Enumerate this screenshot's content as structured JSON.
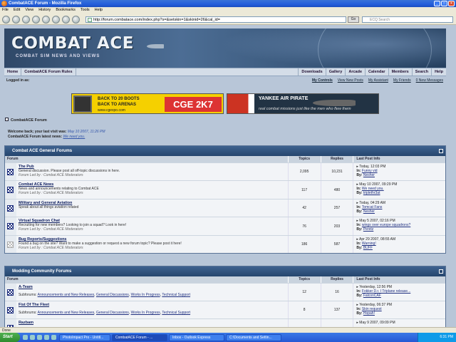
{
  "window": {
    "title": "CombatACE Forum - Mozilla Firefox"
  },
  "menu": [
    "File",
    "Edit",
    "View",
    "History",
    "Bookmarks",
    "Tools",
    "Help"
  ],
  "toolbar": {
    "url": "http://forum.combatace.com/index.php?s=&setskin=1&skinid=26&cal_id=",
    "go_label": "Go",
    "search_placeholder": "ECQ Search"
  },
  "banner": {
    "logo": "COMBAT ACE",
    "tagline": "COMBAT SIM NEWS AND VIEWS"
  },
  "nav": {
    "left": [
      "Home",
      "CombatACE Forum Rules"
    ],
    "right": [
      "Downloads",
      "Gallery",
      "Arcade",
      "Calendar",
      "Members",
      "Search",
      "Help"
    ]
  },
  "userbar": {
    "logged_in_as": "Logged in as:",
    "links": [
      "My Controls",
      "View New Posts",
      "My Assistant",
      "My Friends",
      "0 New Messages"
    ]
  },
  "ads": {
    "ad1": {
      "line1": "BACK TO 20 BOOTS",
      "line2": "BACK TO ARENAS",
      "url": "www.cgexpo.com",
      "brand": "CGE 2K7"
    },
    "ad2": {
      "title": "YANKEE AIR PIRATE",
      "sub": "real combat missions just like the men who flew them"
    }
  },
  "board": {
    "title": "CombatACE Forum"
  },
  "welcome": {
    "line1_prefix": "Welcome back; your last visit was:",
    "line1_value": "May 10 2007, 11:26 PM",
    "line2_prefix": "CombatACE Forum latest news:",
    "line2_value": "We need you."
  },
  "sections": [
    {
      "title": "Combat ACE General Forums",
      "columns": [
        "Forum",
        "Topics",
        "Replies",
        "Last Post Info"
      ],
      "rows": [
        {
          "name": "The Pub",
          "desc": "General discussion. Please post all off-topic discussions in here.",
          "mod": "Forum Led by : Combat ACE Moderators",
          "topics": "2,095",
          "replies": "10,231",
          "lp_date": "Today, 12:03 PM",
          "lp_in_label": "In:",
          "lp_in": "Funny vid",
          "lp_by_label": "By:",
          "lp_by": "Nesher",
          "new": true
        },
        {
          "name": "Combat ACE News",
          "desc": "News and announcements relating to Combat ACE",
          "mod": "Forum Led by : Combat ACE Moderators",
          "topics": "117",
          "replies": "480",
          "lp_date": "May 10 2007, 09:29 PM",
          "lp_in_label": "In:",
          "lp_in": "We need you.",
          "lp_by_label": "By:",
          "lp_by": "triplethr3at",
          "new": true
        },
        {
          "name": "Military and General Aviation",
          "desc": "Speak about all things aviation related",
          "mod": "",
          "topics": "42",
          "replies": "257",
          "lp_date": "Today, 04:29 AM",
          "lp_in_label": "In:",
          "lp_in": "Tomcat Fans",
          "lp_by_label": "By:",
          "lp_by": "Nesher",
          "new": true
        },
        {
          "name": "Virtual Squadron Chat",
          "desc": "Recruiting for new members? Looking to join a squad? Look in here!",
          "mod": "Forum Led by : Combat ACE Moderators",
          "topics": "76",
          "replies": "203",
          "lp_date": "May 5 2007, 02:16 PM",
          "lp_in_label": "In:",
          "lp_in": "wings over europe squadrons?",
          "lp_by_label": "By:",
          "lp_by": "Peretz",
          "new": true
        },
        {
          "name": "Bug Reports/Suggestions",
          "desc": "Found a bug on the site? Want to make a suggestion or request a new forum topic? Please post it here!",
          "mod": "Forum Led by : Combat ACE Moderators",
          "topics": "186",
          "replies": "587",
          "lp_date": "Apr 29 2007, 08:55 AM",
          "lp_in_label": "In:",
          "lp_in": "Warning!",
          "lp_by_label": "By:",
          "lp_by": "BUFF",
          "new": false
        }
      ]
    },
    {
      "title": "Modding Community Forums",
      "columns": [
        "Forum",
        "Topics",
        "Replies",
        "Last Post Info"
      ],
      "rows": [
        {
          "name": "A-Team",
          "sub_label": "Subforums:",
          "subforums": [
            "Announcements and New Releases",
            "General Discussions",
            "Works In Progress",
            "Technical Support"
          ],
          "topics": "12",
          "replies": "16",
          "lp_date": "Yesterday, 12:56 PM",
          "lp_in_label": "In:",
          "lp_in": "Fokker D.r. I Triplane release...",
          "lp_by_label": "By:",
          "lp_by": "FalconCAF",
          "new": true
        },
        {
          "name": "Fist Of The Fleet",
          "sub_label": "Subforums:",
          "subforums": [
            "Announcements and New Releases",
            "General Discussions",
            "Works In Progress",
            "Technical Support"
          ],
          "topics": "8",
          "replies": "137",
          "lp_date": "Yesterday, 06:37 PM",
          "lp_in_label": "In:",
          "lp_in": "Skin request",
          "lp_by_label": "By:",
          "lp_by": "Hopah!",
          "new": true
        },
        {
          "name": "Razbam",
          "sub_label": "",
          "subforums": [],
          "topics": "",
          "replies": "",
          "lp_date": "May 9 2007, 09:09 PM",
          "lp_in_label": "",
          "lp_in": "",
          "lp_by_label": "",
          "lp_by": "",
          "new": true
        }
      ]
    }
  ],
  "status": "Done",
  "taskbar": {
    "start": "Start",
    "tasks": [
      "PhotoImpact Pro - Untitl...",
      "CombatACE Forum - ...",
      "Inbox - Outlook Express",
      "C:\\Documents and Settin..."
    ],
    "clock": "6:31 PM"
  }
}
